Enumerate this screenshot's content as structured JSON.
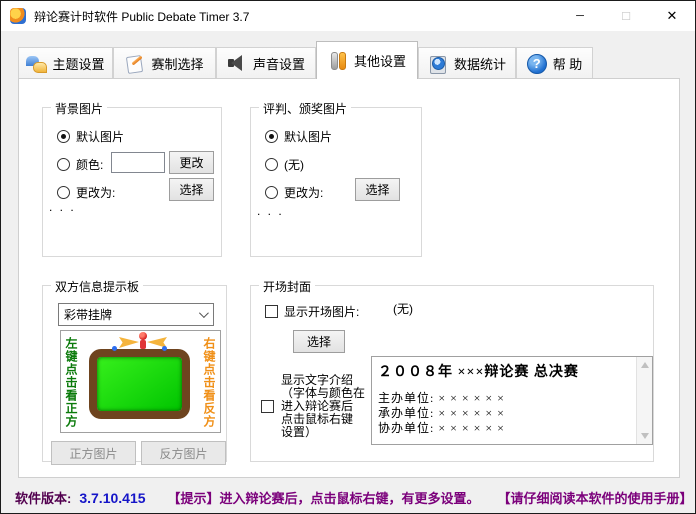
{
  "window": {
    "title": "辩论赛计时软件 Public Debate Timer 3.7",
    "minimize_icon": "─",
    "maximize_icon": "☐",
    "close_icon": "✕"
  },
  "tabs": {
    "theme": "主题设置",
    "format": "赛制选择",
    "sound": "声音设置",
    "other": "其他设置",
    "stats": "数据统计",
    "help": "帮 助"
  },
  "background_group": {
    "title": "背景图片",
    "opt_default": "默认图片",
    "opt_color": "颜色:",
    "opt_change": "更改为:",
    "color_value": "",
    "change_btn": "更改",
    "select_btn": "选择",
    "ellipsis": ". . ."
  },
  "award_group": {
    "title": "评判、颁奖图片",
    "opt_default": "默认图片",
    "opt_none": "(无)",
    "opt_change": "更改为:",
    "select_btn": "选择",
    "ellipsis": ". . ."
  },
  "board_group": {
    "title": "双方信息提示板",
    "dropdown_value": "彩带挂牌",
    "left_text": "左键点击看正方",
    "right_text": "右键点击看反方",
    "pro_btn": "正方图片",
    "con_btn": "反方图片"
  },
  "cover_group": {
    "title": "开场封面",
    "show_image_label": "显示开场图片:",
    "none_label": "(无)",
    "select_btn": "选择",
    "show_text_label_lines": [
      "显示文字介绍",
      "（字体与颜色在",
      "进入辩论赛后",
      "点击鼠标右键",
      "设置）"
    ],
    "intro_title": "２００８年 ×××辩论赛 总决赛",
    "intro_lines": [
      "主办单位: × × × × × ×",
      "承办单位: × × × × × ×",
      "协办单位: × × × × × ×"
    ]
  },
  "status_bar": {
    "version_label": "软件版本:",
    "version_value": "3.7.10.415",
    "tip": "【提示】进入辩论赛后，点击鼠标右键，有更多设置。",
    "manual": "【请仔细阅读本软件的使用手册】"
  },
  "colors": {
    "accent_blue": "#1515c8",
    "status_purple": "#7b007b",
    "left_text_green": "#0a7a0a",
    "right_text_orange": "#f09018",
    "board_green": "#00c400",
    "frame_brown": "#6e441f"
  }
}
